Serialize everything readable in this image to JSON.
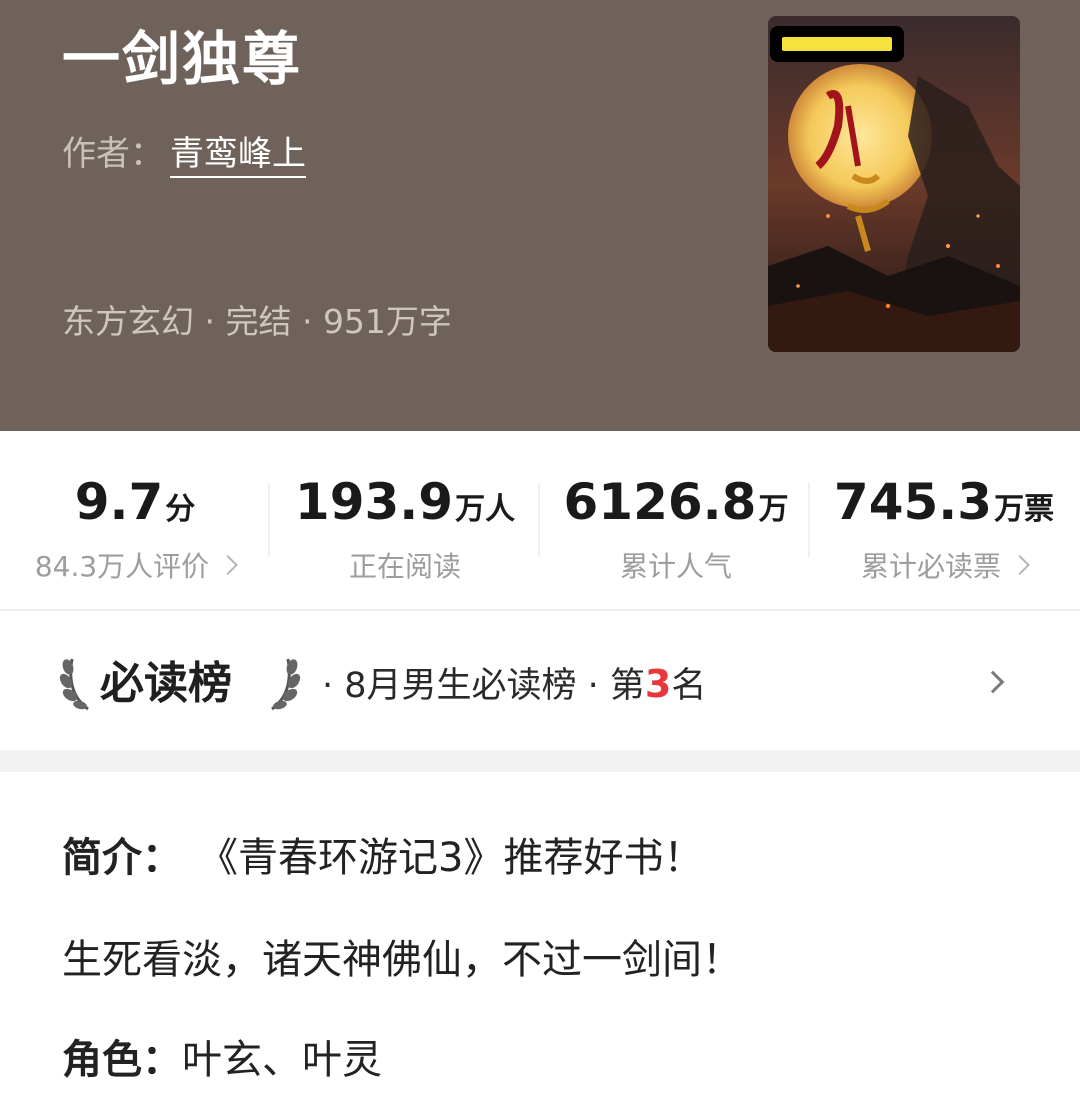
{
  "book": {
    "title": "一剑独尊",
    "author_label": "作者：",
    "author_name": "青鸾峰上",
    "meta": "东方玄幻 · 完结 · 951万字"
  },
  "colors": {
    "header_bg": "#6e625b",
    "rank_highlight": "#e8363a",
    "cover_badge_bar": "#f6e23c"
  },
  "stats": [
    {
      "value": "9.7",
      "unit": "分",
      "label": "84.3万人评价",
      "has_chevron": true
    },
    {
      "value": "193.9",
      "unit": "万人",
      "label": "正在阅读",
      "has_chevron": false
    },
    {
      "value": "6126.8",
      "unit": "万",
      "label": "累计人气",
      "has_chevron": false
    },
    {
      "value": "745.3",
      "unit": "万票",
      "label": "累计必读票",
      "has_chevron": true
    }
  ],
  "ranking": {
    "badge": "必读榜",
    "prefix": "· 8月男生必读榜 · 第",
    "rank": "3",
    "suffix": "名",
    "icon_left": "laurel-left-icon",
    "icon_right": "laurel-right-icon",
    "chevron": "chevron-right-icon"
  },
  "intro": {
    "label": "简介：",
    "line1": "《青春环游记3》推荐好书！",
    "line2": "生死看淡，诸天神佛仙，不过一剑间！",
    "roles_label": "角色：",
    "roles": "叶玄、叶灵"
  }
}
